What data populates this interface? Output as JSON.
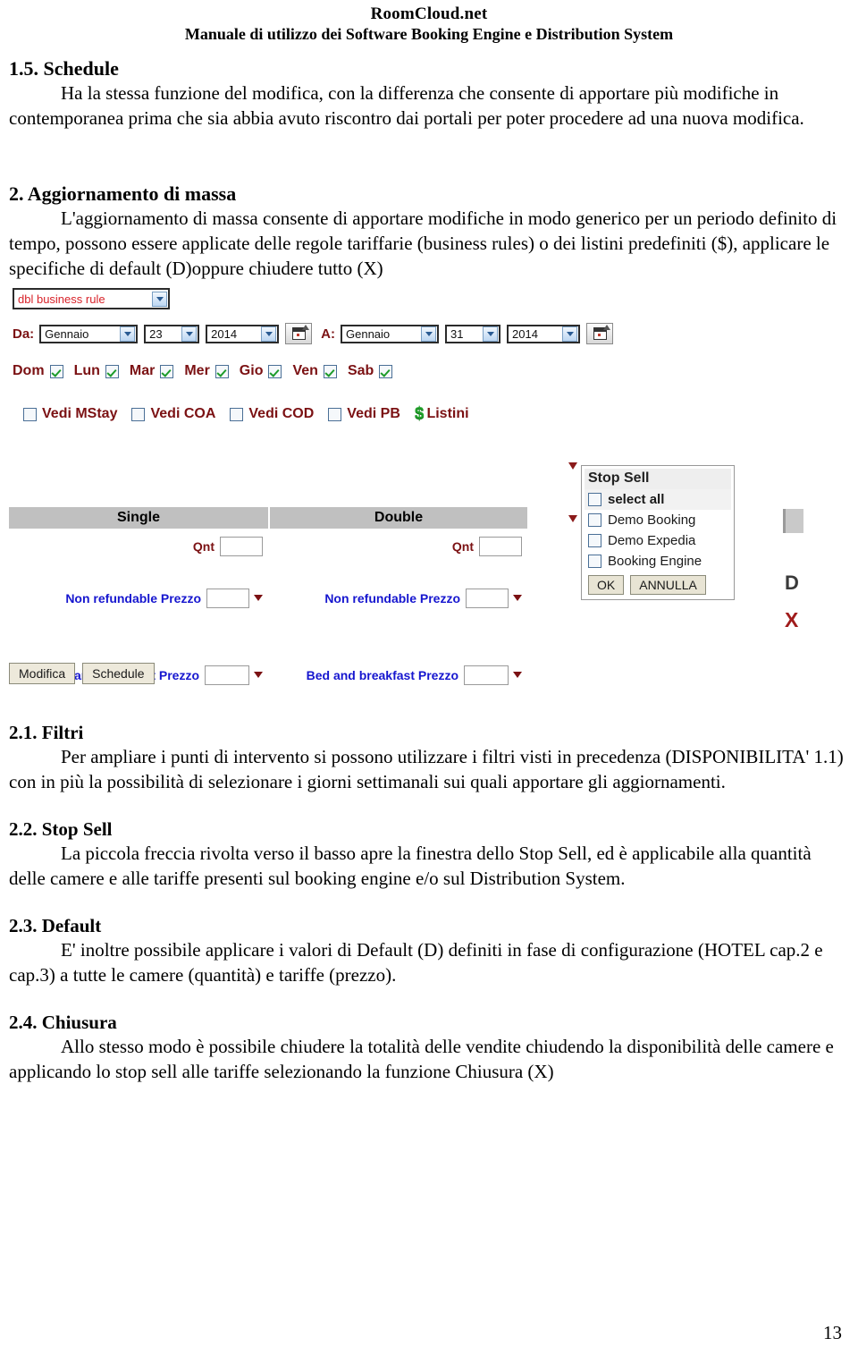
{
  "header": {
    "site": "RoomCloud.net",
    "subtitle": "Manuale di utilizzo dei Software Booking Engine e Distribution System"
  },
  "sections": [
    {
      "heading": "1.5. Schedule",
      "paragraph": "Ha la stessa funzione del modifica, con la differenza che consente di apportare più modifiche in contemporanea prima che sia abbia avuto riscontro dai portali per poter procedere ad una nuova modifica."
    },
    {
      "heading": "2. Aggiornamento di massa",
      "paragraph": "L'aggiornamento di massa consente di apportare modifiche in modo generico per un periodo definito di tempo, possono essere applicate delle regole tariffarie (business rules) o dei listini predefiniti ($), applicare le specifiche di default (D)oppure chiudere tutto (X)"
    },
    {
      "heading": "2.1. Filtri",
      "paragraph": "Per ampliare i punti di intervento si possono utilizzare i filtri visti in precedenza (DISPONIBILITA' 1.1) con in più la possibilità di selezionare i giorni settimanali sui quali apportare gli aggiornamenti."
    },
    {
      "heading": "2.2. Stop Sell",
      "paragraph": "La piccola freccia rivolta verso il basso apre la finestra dello Stop Sell, ed è applicabile alla quantità delle camere e alle tariffe presenti sul booking engine e/o sul Distribution System."
    },
    {
      "heading": "2.3. Default",
      "paragraph": "E' inoltre possibile applicare i valori di Default (D) definiti in fase di configurazione (HOTEL cap.2 e cap.3) a tutte le camere (quantità) e tariffe (prezzo)."
    },
    {
      "heading": "2.4. Chiusura",
      "paragraph": "Allo stesso modo è possibile chiudere la totalità delle vendite chiudendo la disponibilità delle camere e applicando lo stop sell alle tariffe selezionando la funzione Chiusura (X)"
    }
  ],
  "app": {
    "rule_select": {
      "value": "dbl business rule",
      "color": "#d8232a"
    },
    "date_from": {
      "label": "Da:",
      "month": "Gennaio",
      "day": "23",
      "year": "2014",
      "calendar_icon": "calendar-icon"
    },
    "date_to": {
      "label": "A:",
      "month": "Gennaio",
      "day": "31",
      "year": "2014",
      "calendar_icon": "calendar-icon"
    },
    "days": [
      {
        "label": "Dom",
        "checked": true
      },
      {
        "label": "Lun",
        "checked": true
      },
      {
        "label": "Mar",
        "checked": true
      },
      {
        "label": "Mer",
        "checked": true
      },
      {
        "label": "Gio",
        "checked": true
      },
      {
        "label": "Ven",
        "checked": true
      },
      {
        "label": "Sab",
        "checked": true
      }
    ],
    "view_options": [
      {
        "label": "Vedi MStay",
        "checked": false
      },
      {
        "label": "Vedi COA",
        "checked": false
      },
      {
        "label": "Vedi COD",
        "checked": false
      },
      {
        "label": "Vedi PB",
        "checked": false
      }
    ],
    "listini": {
      "icon": "dollar-icon",
      "label": "Listini"
    },
    "rate_table": {
      "columns": [
        "Single",
        "Double"
      ],
      "rows": [
        {
          "type": "quantity",
          "labels": [
            "Qnt",
            "Qnt"
          ],
          "values": [
            "",
            ""
          ],
          "has_arrow": false
        },
        {
          "type": "rate",
          "labels": [
            "Non refundable Prezzo",
            "Non refundable Prezzo"
          ],
          "values": [
            "",
            ""
          ],
          "has_arrow": true
        },
        {
          "type": "rate",
          "labels": [
            "Bed and breakfast Prezzo",
            "Bed and breakfast Prezzo"
          ],
          "values": [
            "",
            ""
          ],
          "has_arrow": true
        }
      ]
    },
    "stop_sell": {
      "title": "Stop Sell",
      "options": [
        {
          "label": "select all",
          "checked": false
        },
        {
          "label": "Demo Booking",
          "checked": false
        },
        {
          "label": "Demo Expedia",
          "checked": false
        },
        {
          "label": "Booking Engine",
          "checked": false
        }
      ],
      "ok_label": "OK",
      "cancel_label": "ANNULLA"
    },
    "markers": {
      "default_marker": "D",
      "close_marker": "X",
      "default_color": "#3a3a3a",
      "close_color": "#a01c1c"
    },
    "actions": {
      "modifica": "Modifica",
      "schedule": "Schedule"
    }
  },
  "footer": {
    "page_number": "13"
  }
}
